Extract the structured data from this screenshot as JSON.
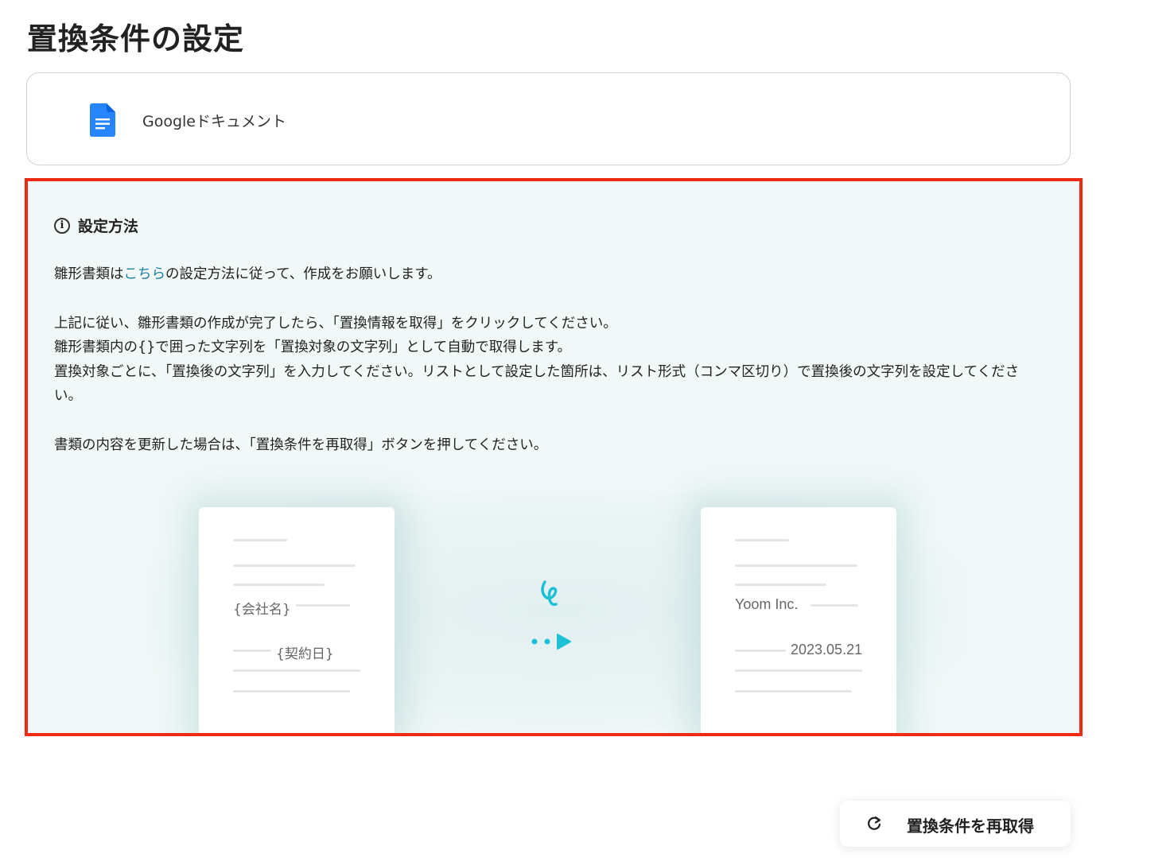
{
  "page": {
    "title": "置換条件の設定"
  },
  "app": {
    "name": "Googleドキュメント",
    "icon": "google-docs-icon",
    "icon_color": "#2684fc"
  },
  "info": {
    "heading": "設定方法",
    "line1_pre": "雛形書類は",
    "line1_link": "こちら",
    "line1_post": "の設定方法に従って、作成をお願いします。",
    "line2": "上記に従い、雛形書類の作成が完了したら、「置換情報を取得」をクリックしてください。",
    "line3": "雛形書類内の{}で囲った文字列を「置換対象の文字列」として自動で取得します。",
    "line4": "置換対象ごとに、「置換後の文字列」を入力してください。リストとして設定した箇所は、リスト形式（コンマ区切り）で置換後の文字列を設定してください。",
    "line5": "書類の内容を更新した場合は、「置換条件を再取得」ボタンを押してください。",
    "border_color": "#ee2a12",
    "background": "#f1f9f8",
    "link_color": "#1b7fa0"
  },
  "illustration": {
    "template": {
      "placeholder1": "{会社名}",
      "placeholder2": "{契約日}"
    },
    "result": {
      "value1": "Yoom Inc.",
      "value2": "2023.05.21"
    },
    "accent_color": "#1ec0d6"
  },
  "actions": {
    "refresh_label": "置換条件を再取得",
    "refresh_icon": "refresh-icon"
  }
}
